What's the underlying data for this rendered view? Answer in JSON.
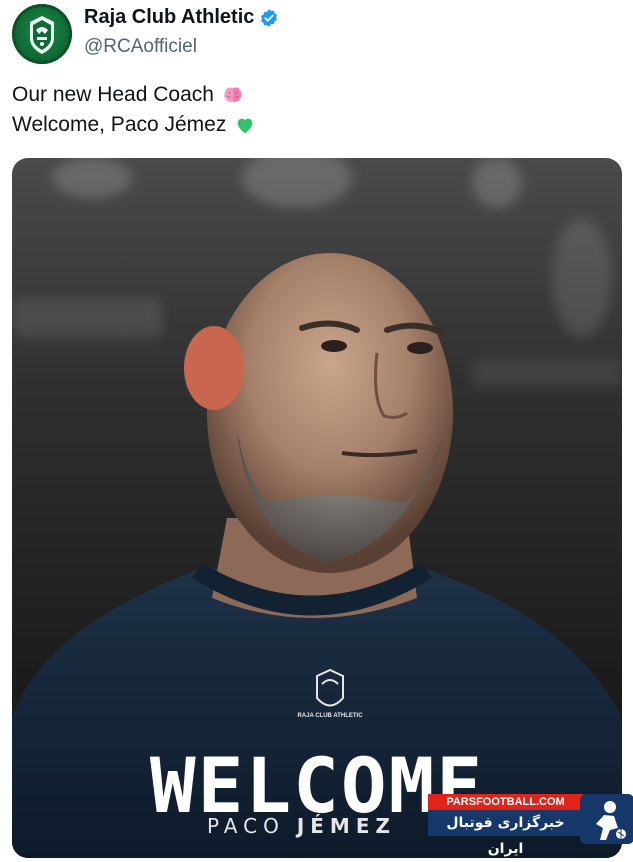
{
  "author": {
    "display_name": "Raja Club Athletic",
    "handle": "@RCAofficiel",
    "avatar_icon": "raja-crest-icon",
    "verified_icon": "verified-badge-icon",
    "verified_color": "#1d9bf0"
  },
  "tweet": {
    "line1": "Our new Head Coach",
    "line1_emoji": "brain-icon",
    "line2": "Welcome, Paco Jémez",
    "line2_emoji": "green-heart-icon"
  },
  "media": {
    "headline": "WELCOME",
    "first_name": "PACO",
    "last_name": "JÉMEZ",
    "shirt_crest_text": "RAJA CLUB ATHLETIC"
  },
  "watermark": {
    "site": "PARSFOOTBALL.COM",
    "tagline": "خبرگزاری فوتبال ایران",
    "brand_color": "#15376a",
    "accent_color": "#e1241b"
  }
}
